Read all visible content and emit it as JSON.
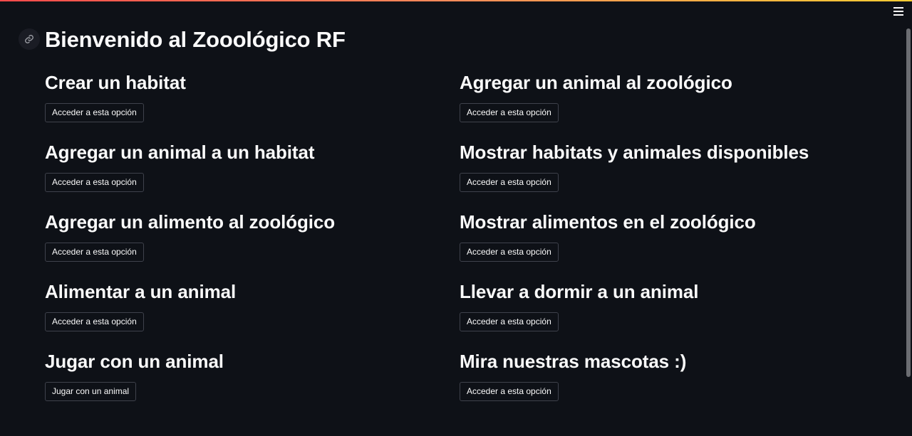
{
  "header": {
    "title": "Bienvenido al Zooológico RF",
    "menu_icon": "hamburger-menu-icon",
    "anchor_icon": "link-icon"
  },
  "options": [
    {
      "title": "Crear un habitat",
      "button": "Acceder a esta opción"
    },
    {
      "title": "Agregar un animal al zoológico",
      "button": "Acceder a esta opción"
    },
    {
      "title": "Agregar un animal a un habitat",
      "button": "Acceder a esta opción"
    },
    {
      "title": "Mostrar habitats y animales disponibles",
      "button": "Acceder a esta opción"
    },
    {
      "title": "Agregar un alimento al zoológico",
      "button": "Acceder a esta opción"
    },
    {
      "title": "Mostrar alimentos en el zoológico",
      "button": "Acceder a esta opción"
    },
    {
      "title": "Alimentar a un animal",
      "button": "Acceder a esta opción"
    },
    {
      "title": "Llevar a dormir a un animal",
      "button": "Acceder a esta opción"
    },
    {
      "title": "Jugar con un animal",
      "button": "Jugar con un animal"
    },
    {
      "title": "Mira nuestras mascotas :)",
      "button": "Acceder a esta opción"
    }
  ],
  "colors": {
    "background": "#0e1117",
    "text": "#fafafa",
    "button_border": "#3f424c",
    "accent": "#ff4b4b"
  }
}
